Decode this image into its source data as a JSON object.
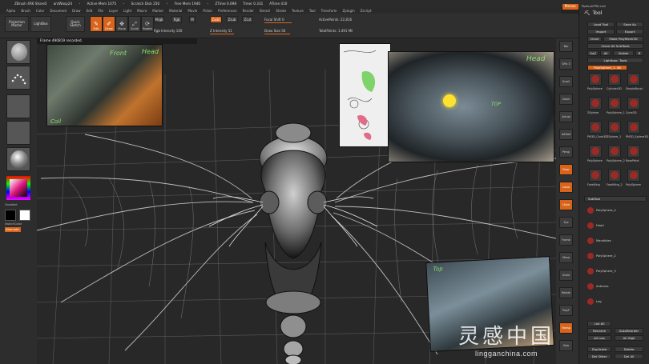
{
  "titlebar": {
    "app": "ZBrush 4R6 Share5",
    "file": "antWasp24",
    "active_mem": "Active Mem 1075",
    "scratch": "Scratch Disk 256",
    "free_mem": "Free Mem 1940",
    "ztime": "ZTime 0.698",
    "timer": "Timer 0.331",
    "atime": "ATime 410",
    "menus": "Menus",
    "script": "DefaultZScript"
  },
  "menubar": [
    "Alpha",
    "Brush",
    "Color",
    "Document",
    "Draw",
    "Edit",
    "File",
    "Layer",
    "Light",
    "Macro",
    "Marker",
    "Material",
    "Movie",
    "Picker",
    "Preferences",
    "Render",
    "Stencil",
    "Stroke",
    "Texture",
    "Tool",
    "Transform",
    "Zplugin",
    "Zscript"
  ],
  "toolbar": {
    "projection_master": "Projection Master",
    "lightbox": "LightBox",
    "quick_sketch": "Quick Sketch",
    "icons": [
      {
        "label": "Edit",
        "glyph": "✎"
      },
      {
        "label": "Draw",
        "glyph": "✐"
      },
      {
        "label": "Move",
        "glyph": "✥"
      },
      {
        "label": "Scale",
        "glyph": "⤢"
      },
      {
        "label": "Rotate",
        "glyph": "⟳"
      }
    ],
    "mrgb": "Mrgb",
    "rgb": "Rgb",
    "m": "M",
    "zadd": "Zadd",
    "zsub": "Zsub",
    "zcut": "Zcut",
    "rgb_intensity": "Rgb Intensity 100",
    "z_intensity": "Z Intensity 51",
    "focal_shift": "Focal Shift 0",
    "draw_size": "Draw Size 56",
    "active_points": "ActivePoints: 22,816",
    "total_points": "TotalPoints: 1.491 Mil"
  },
  "canvas": {
    "status": "Frame 490819 recorded.",
    "ref_top_left": {
      "labels": [
        "Front",
        "Head",
        "Coil"
      ]
    },
    "ref_head": {
      "labels": [
        "Head",
        "TOP"
      ]
    },
    "ref_bottom": {
      "labels": [
        "Top"
      ]
    }
  },
  "lefttray": {
    "gradient": "Gradient",
    "switch_color": "SwitchColor",
    "alternate": "Alternate"
  },
  "righttray": [
    "Bpr",
    "SPix 3",
    "Scroll",
    "Zoom",
    "Actual",
    "AAHalf",
    "Persp",
    "Floor",
    "Local",
    "LSym",
    "Xyz",
    "Frame",
    "Move",
    "Scale",
    "Rotate",
    "PolyF",
    "Transp",
    "Solo"
  ],
  "toolpanel": {
    "title": "Tool",
    "load_tool": "Load Tool",
    "save_as": "Save As",
    "import": "Import",
    "export": "Export",
    "clone": "Clone",
    "make_polymesh": "Make PolyMesh3D",
    "goz": "GoZ",
    "all": "All",
    "visible": "Visible",
    "r": "R",
    "clone_all": "Clone All SubTools",
    "lightbox_tools": "Lightbox› Tools",
    "current_tool": "PolySphere_1. 48",
    "tools": [
      "PolySphere",
      "Cylinder3D",
      "SimpleBrush",
      "ZSphere",
      "PolySphere_1",
      "Cone3D",
      "PM3D_Cone3D",
      "ZSphere_1",
      "PM3D_Sphere3D",
      "PolySphere",
      "PolySphere_2",
      "RosePetal",
      "ForeWing",
      "ForeWing_2",
      "PolySphere"
    ],
    "subtool_header": "SubTool",
    "subtools": [
      "PolySphere_4",
      "Head",
      "Mandibles",
      "PolySphere_2",
      "PolySphere_3",
      "Antenna",
      "Leg"
    ],
    "list_all": "List All",
    "rename": "Rename",
    "autoreorder": "AutoReorder",
    "all_low": "All Low",
    "all_high": "All High",
    "duplicate": "Duplicate",
    "delete": "Delete",
    "del_other": "Del Other",
    "del_all": "Del All"
  },
  "watermark": {
    "cn": "灵感中国",
    "url": "lingganchina.com"
  },
  "colors": {
    "accent": "#d8641b",
    "bg": "#232323",
    "panel": "#2b2b2b"
  }
}
